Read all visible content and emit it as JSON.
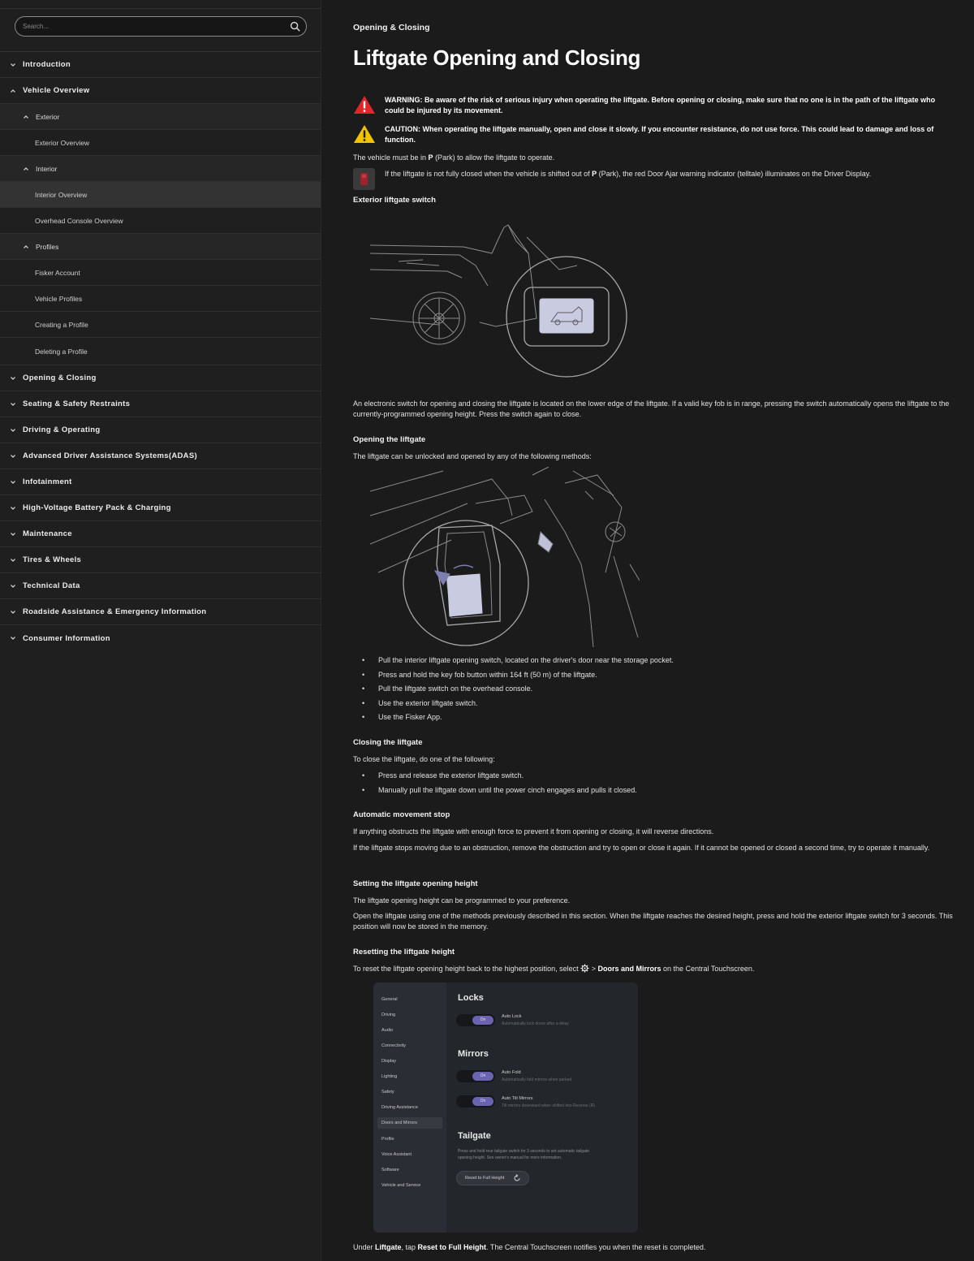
{
  "search": {
    "placeholder": "Search..."
  },
  "sidebar": {
    "items": [
      {
        "label": "Introduction"
      },
      {
        "label": "Vehicle Overview"
      },
      {
        "label": "Exterior"
      },
      {
        "label": "Exterior Overview"
      },
      {
        "label": "Interior"
      },
      {
        "label": "Interior Overview"
      },
      {
        "label": "Overhead Console Overview"
      },
      {
        "label": "Profiles"
      },
      {
        "label": "Fisker Account"
      },
      {
        "label": "Vehicle Profiles"
      },
      {
        "label": "Creating a Profile"
      },
      {
        "label": "Deleting a Profile"
      },
      {
        "label": "Opening & Closing"
      },
      {
        "label": "Seating & Safety Restraints"
      },
      {
        "label": "Driving & Operating"
      },
      {
        "label": "Advanced Driver Assistance Systems(ADAS)"
      },
      {
        "label": "Infotainment"
      },
      {
        "label": "High-Voltage Battery Pack & Charging"
      },
      {
        "label": "Maintenance"
      },
      {
        "label": "Tires & Wheels"
      },
      {
        "label": "Technical Data"
      },
      {
        "label": "Roadside Assistance & Emergency Information"
      },
      {
        "label": "Consumer Information"
      }
    ]
  },
  "main": {
    "breadcrumb": "Opening & Closing",
    "title": "Liftgate Opening and Closing",
    "warning": "WARNING: Be aware of the risk of serious injury when operating the liftgate. Before opening or closing, make sure that no one is in the path of the liftgate who could be injured by its movement.",
    "caution": "CAUTION: When operating the liftgate manually, open and close it slowly. If you encounter resistance, do not use force. This could lead to damage and loss of function.",
    "park_prefix": "The vehicle must be in ",
    "park_bold": "P",
    "park_suffix": " (Park) to allow the liftgate to operate.",
    "telltale_prefix": "If the liftgate is not fully closed when the vehicle is shifted out of ",
    "telltale_bold": "P",
    "telltale_suffix": " (Park), the red Door Ajar warning indicator (telltale) illuminates on the Driver Display.",
    "exterior_switch_heading": "Exterior liftgate switch",
    "exterior_switch_text": "An electronic switch for opening and closing the liftgate is located on the lower edge of the liftgate. If a valid key fob is in range, pressing the switch automatically opens the liftgate to the currently-programmed opening height. Press the switch again to close.",
    "opening_heading": "Opening the liftgate",
    "opening_intro": "The liftgate can be unlocked and opened by any of the following methods:",
    "opening_methods": [
      "Pull the interior liftgate opening switch, located on the driver's door near the storage pocket.",
      "Press and hold the key fob button within 164 ft (50 m) of the liftgate.",
      "Pull the liftgate switch on the overhead console.",
      "Use the exterior liftgate switch.",
      "Use the Fisker App."
    ],
    "closing_heading": "Closing the liftgate",
    "closing_intro": "To close the liftgate, do one of the following:",
    "closing_methods": [
      "Press and release the exterior liftgate switch.",
      "Manually pull the liftgate down until the power cinch engages and pulls it closed."
    ],
    "auto_stop_heading": "Automatic movement stop",
    "auto_stop_text1": "If anything obstructs the liftgate with enough force to prevent it from opening or closing, it will reverse directions.",
    "auto_stop_text2": "If the liftgate stops moving due to an obstruction, remove the obstruction and try to open or close it again. If it cannot be opened or closed a second time, try to operate it manually.",
    "height_heading": "Setting the liftgate opening height",
    "height_text1": "The liftgate opening height can be programmed to your preference.",
    "height_text2": "Open the liftgate using one of the methods previously described in this section. When the liftgate reaches the desired height, press and hold the exterior liftgate switch for 3 seconds. This position will now be stored in the memory.",
    "reset_heading": "Resetting the liftgate height",
    "reset_prefix": "To reset the liftgate opening height back to the highest position, select ",
    "reset_arrow": " > ",
    "reset_bold": "Doors and Mirrors",
    "reset_suffix": " on the Central Touchscreen.",
    "final_prefix": "Under ",
    "final_bold1": "Liftgate",
    "final_mid": ", tap ",
    "final_bold2": "Reset to Full Height",
    "final_suffix": ". The Central Touchscreen notifies you when the reset is completed."
  },
  "settings_ui": {
    "menu": [
      "General",
      "Driving",
      "Audio",
      "Connectivity",
      "Display",
      "Lighting",
      "Safety",
      "Driving Assistance",
      "Doors and Mirrors",
      "Profile",
      "Voice Assistant",
      "Software",
      "Vehicle and Service"
    ],
    "locks_title": "Locks",
    "auto_lock_label": "Auto Lock",
    "auto_lock_desc": "Automatically lock doors after a delay",
    "mirrors_title": "Mirrors",
    "auto_fold_label": "Auto Fold",
    "auto_fold_desc": "Automatically fold mirrors when parked",
    "auto_tilt_label": "Auto Tilt Mirrors",
    "auto_tilt_desc": "Tilt mirrors downward when shifted into Reverse (R)",
    "tailgate_title": "Tailgate",
    "tailgate_desc1": "Press and hold rear tailgate switch for 3 seconds to set automatic tailgate",
    "tailgate_desc2": "opening height. See owner's manual for more information.",
    "reset_button": "Reset to Full Height",
    "toggle_on": "On"
  },
  "colors": {
    "warning_red": "#e0262b",
    "caution_yellow": "#f2c300",
    "accent_purple": "#6a63b0"
  }
}
